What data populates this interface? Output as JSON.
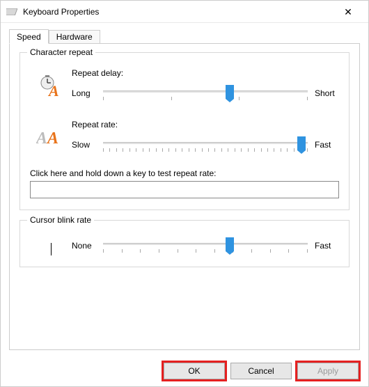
{
  "window": {
    "title": "Keyboard Properties"
  },
  "tabs": {
    "speed": "Speed",
    "hardware": "Hardware",
    "active": "speed"
  },
  "character_repeat": {
    "legend": "Character repeat",
    "repeat_delay": {
      "label": "Repeat delay:",
      "min_label": "Long",
      "max_label": "Short",
      "value_percent": 62
    },
    "repeat_rate": {
      "label": "Repeat rate:",
      "min_label": "Slow",
      "max_label": "Fast",
      "value_percent": 97
    },
    "test": {
      "label": "Click here and hold down a key to test repeat rate:",
      "value": ""
    }
  },
  "cursor_blink": {
    "legend": "Cursor blink rate",
    "min_label": "None",
    "max_label": "Fast",
    "value_percent": 62
  },
  "buttons": {
    "ok": "OK",
    "cancel": "Cancel",
    "apply": "Apply"
  }
}
